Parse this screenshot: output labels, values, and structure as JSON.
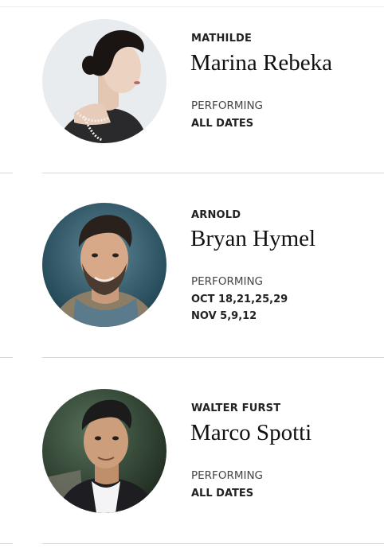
{
  "cast": [
    {
      "role": "MATHILDE",
      "name": "Marina Rebeka",
      "performing_label": "PERFORMING",
      "dates": "ALL DATES"
    },
    {
      "role": "ARNOLD",
      "name": "Bryan Hymel",
      "performing_label": "PERFORMING",
      "dates": "OCT 18,21,25,29\nNOV 5,9,12"
    },
    {
      "role": "WALTER FURST",
      "name": "Marco Spotti",
      "performing_label": "PERFORMING",
      "dates": "ALL DATES"
    }
  ],
  "colors": {
    "divider": "#d8d8d8",
    "text_primary": "#111111",
    "text_secondary": "#444444"
  }
}
